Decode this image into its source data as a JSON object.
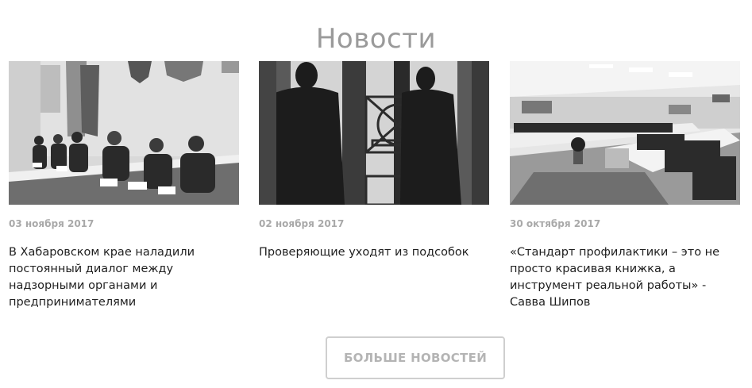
{
  "section": {
    "title": "Новости"
  },
  "news": [
    {
      "date": "03 ноября 2017",
      "title": "В Хабаровском крае наладили постоянный диалог между надзорными органами и предпринимателями",
      "image_icon": "meeting-photo"
    },
    {
      "date": "02 ноября 2017",
      "title": "Проверяющие уходят из подсобок",
      "image_icon": "inspectors-door-photo"
    },
    {
      "date": "30 октября 2017",
      "title": "«Стандарт профилактики – это не просто красивая книжка, а инструмент реальной работы» - Савва Шипов",
      "image_icon": "conference-hall-photo"
    }
  ],
  "more_button": {
    "label": "БОЛЬШЕ НОВОСТЕЙ"
  }
}
